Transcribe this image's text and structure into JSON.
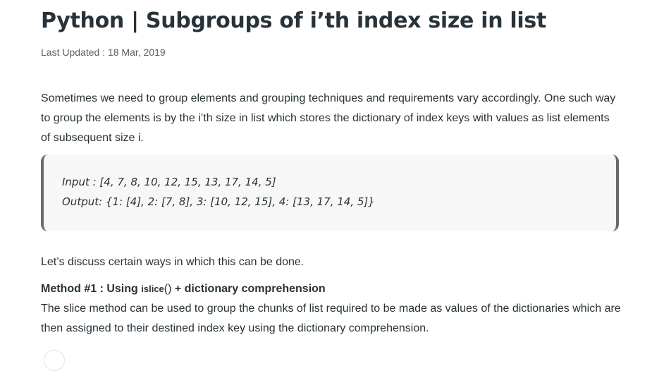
{
  "article": {
    "title": "Python | Subgroups of i’th index size in list",
    "last_updated": "Last Updated : 18 Mar, 2019",
    "intro": "Sometimes we need to group elements and grouping techniques and requirements vary accordingly. One such way to group the elements is by the i’th size in list which stores the dictionary of index keys with values as list elements of subsequent size i.",
    "example": {
      "input": "Input : [4, 7, 8, 10, 12, 15, 13, 17, 14, 5]",
      "output": "Output: {1: [4], 2: [7, 8], 3: [10, 12, 15], 4: [13, 17, 14, 5]}"
    },
    "discuss": "Let’s discuss certain ways in which this can be done.",
    "method1": {
      "prefix": "Method #1 : Using ",
      "fn": "islice",
      "paren": "()",
      "suffix": " + dictionary comprehension",
      "description": "The slice method can be used to group the chunks of list required to be made as values of the dictionaries which are then assigned to their destined index key using the dictionary comprehension."
    }
  }
}
